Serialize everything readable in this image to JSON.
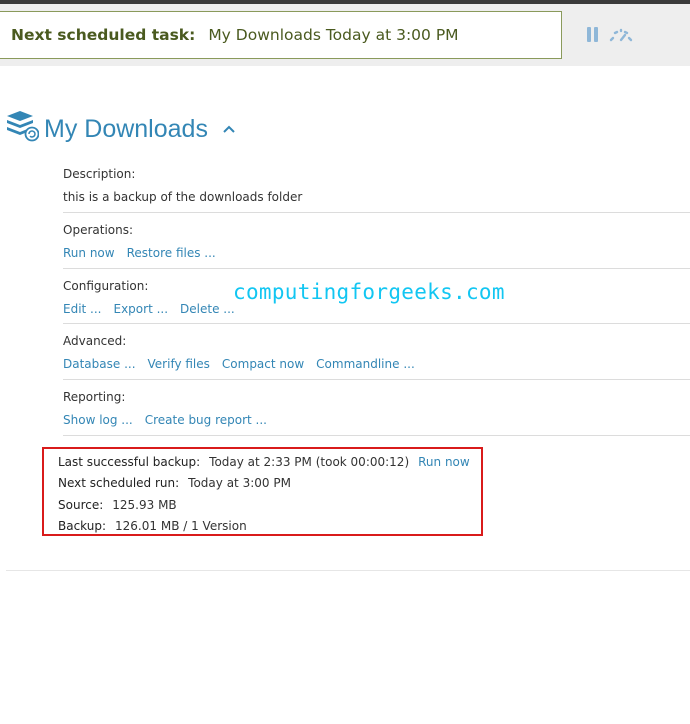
{
  "topbar": {
    "task_label": "Next scheduled task:",
    "task_value": "My Downloads Today at 3:00 PM",
    "pause_icon": "pause-icon",
    "throttle_icon": "throttle-icon"
  },
  "backup": {
    "title": "My Downloads",
    "icon": "database-backup-icon",
    "collapse_icon": "chevron-up-icon",
    "description_label": "Description:",
    "description": "this is a backup of the downloads folder",
    "operations_label": "Operations:",
    "operations": [
      "Run now",
      "Restore files ..."
    ],
    "configuration_label": "Configuration:",
    "configuration": [
      "Edit ...",
      "Export ...",
      "Delete ..."
    ],
    "advanced_label": "Advanced:",
    "advanced": [
      "Database ...",
      "Verify files",
      "Compact now",
      "Commandline ..."
    ],
    "reporting_label": "Reporting:",
    "reporting": [
      "Show log ...",
      "Create bug report ..."
    ]
  },
  "status": {
    "last_backup_label": "Last successful backup:",
    "last_backup_value": "Today at 2:33 PM (took 00:00:12)",
    "run_now": "Run now",
    "next_run_label": "Next scheduled run:",
    "next_run_value": "Today at 3:00 PM",
    "source_label": "Source:",
    "source_value": "125.93 MB",
    "backup_label": "Backup:",
    "backup_value": "126.01 MB / 1 Version"
  },
  "watermark": "computingforgeeks.com",
  "colors": {
    "link": "#3386b5",
    "task_text": "#4a5a1f",
    "highlight_border": "#d91b1b",
    "watermark": "#12c6f2"
  }
}
